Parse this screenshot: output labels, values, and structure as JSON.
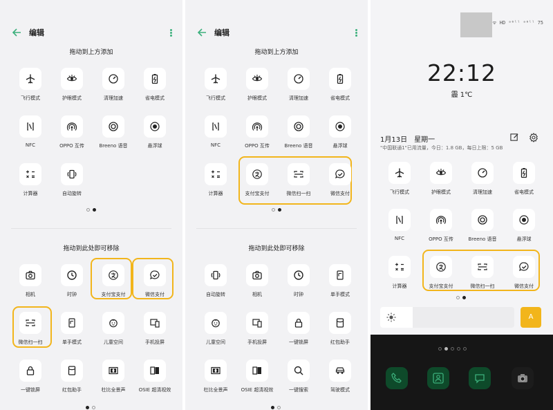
{
  "editor": {
    "title": "编辑",
    "add_section_title": "拖动到上方添加",
    "remove_section_title": "拖动到此处即可移除"
  },
  "panel1": {
    "available": [
      {
        "label": "飞行模式",
        "icon": "airplane-icon"
      },
      {
        "label": "护眼模式",
        "icon": "eye-icon"
      },
      {
        "label": "清理加速",
        "icon": "speed-icon"
      },
      {
        "label": "省电模式",
        "icon": "battery-icon"
      },
      {
        "label": "NFC",
        "icon": "nfc-icon"
      },
      {
        "label": "OPPO 互传",
        "icon": "share-icon"
      },
      {
        "label": "Breeno 语音",
        "icon": "voice-icon"
      },
      {
        "label": "悬浮球",
        "icon": "float-ball-icon"
      },
      {
        "label": "计算器",
        "icon": "calculator-icon"
      },
      {
        "label": "自动旋转",
        "icon": "rotate-icon"
      }
    ],
    "removable": [
      {
        "label": "相机",
        "icon": "camera-icon"
      },
      {
        "label": "时钟",
        "icon": "clock-icon"
      },
      {
        "label": "支付宝支付",
        "icon": "alipay-icon"
      },
      {
        "label": "微信支付",
        "icon": "wechat-pay-icon"
      },
      {
        "label": "微信扫一扫",
        "icon": "scan-icon"
      },
      {
        "label": "单手模式",
        "icon": "one-hand-icon"
      },
      {
        "label": "儿童空间",
        "icon": "kid-icon"
      },
      {
        "label": "手机投屏",
        "icon": "cast-icon"
      },
      {
        "label": "一键锁屏",
        "icon": "lock-icon"
      },
      {
        "label": "红包助手",
        "icon": "redpacket-icon"
      },
      {
        "label": "杜比全景声",
        "icon": "dolby-icon"
      },
      {
        "label": "OSIE 超清视效",
        "icon": "osie-icon"
      }
    ]
  },
  "panel2": {
    "available": [
      {
        "label": "飞行模式",
        "icon": "airplane-icon"
      },
      {
        "label": "护眼模式",
        "icon": "eye-icon"
      },
      {
        "label": "清理加速",
        "icon": "speed-icon"
      },
      {
        "label": "省电模式",
        "icon": "battery-icon"
      },
      {
        "label": "NFC",
        "icon": "nfc-icon"
      },
      {
        "label": "OPPO 互传",
        "icon": "share-icon"
      },
      {
        "label": "Breeno 语音",
        "icon": "voice-icon"
      },
      {
        "label": "悬浮球",
        "icon": "float-ball-icon"
      },
      {
        "label": "计算器",
        "icon": "calculator-icon"
      },
      {
        "label": "支付宝支付",
        "icon": "alipay-icon"
      },
      {
        "label": "微信扫一扫",
        "icon": "scan-icon"
      },
      {
        "label": "微信支付",
        "icon": "wechat-pay-icon"
      }
    ],
    "removable": [
      {
        "label": "自动旋转",
        "icon": "rotate-icon"
      },
      {
        "label": "相机",
        "icon": "camera-icon"
      },
      {
        "label": "时钟",
        "icon": "clock-icon"
      },
      {
        "label": "单手模式",
        "icon": "one-hand-icon"
      },
      {
        "label": "儿童空间",
        "icon": "kid-icon"
      },
      {
        "label": "手机投屏",
        "icon": "cast-icon"
      },
      {
        "label": "一键锁屏",
        "icon": "lock-icon"
      },
      {
        "label": "红包助手",
        "icon": "redpacket-icon"
      },
      {
        "label": "杜比全景声",
        "icon": "dolby-icon"
      },
      {
        "label": "OSIE 超清视效",
        "icon": "osie-icon"
      },
      {
        "label": "一键搜索",
        "icon": "search-icon"
      },
      {
        "label": "驾驶模式",
        "icon": "car-icon"
      }
    ]
  },
  "panel3": {
    "status_icons": "ᯤ HD ᵃ⁶ˡˡ ᵃ⁶ˡˡ 75",
    "time": "22:12",
    "weather": "霾 1℃",
    "date": "1月13日",
    "weekday": "星期一",
    "usage": "\"中国联通1\"已用流量，今日：1.8 GB，每日上限：5 GB",
    "toggles": [
      {
        "label": "飞行模式",
        "icon": "airplane-icon"
      },
      {
        "label": "护眼模式",
        "icon": "eye-icon"
      },
      {
        "label": "清理加速",
        "icon": "speed-icon"
      },
      {
        "label": "省电模式",
        "icon": "battery-icon"
      },
      {
        "label": "NFC",
        "icon": "nfc-icon"
      },
      {
        "label": "OPPO 互传",
        "icon": "share-icon"
      },
      {
        "label": "Breeno 语音",
        "icon": "voice-icon"
      },
      {
        "label": "悬浮球",
        "icon": "float-ball-icon"
      },
      {
        "label": "计算器",
        "icon": "calculator-icon"
      },
      {
        "label": "支付宝支付",
        "icon": "alipay-icon"
      },
      {
        "label": "微信扫一扫",
        "icon": "scan-icon"
      },
      {
        "label": "微信支付",
        "icon": "wechat-pay-icon"
      }
    ],
    "auto_brightness_label": "A",
    "brightness_level": 0.24,
    "dock_apps": [
      {
        "icon": "phone-icon",
        "color": "#0e4a2a"
      },
      {
        "icon": "contacts-icon",
        "color": "#0e4a2a"
      },
      {
        "icon": "messages-icon",
        "color": "#0e4a2a"
      },
      {
        "icon": "camera-icon",
        "color": "#1c1c1c"
      }
    ]
  },
  "colors": {
    "accent_green": "#3cb07c",
    "highlight_yellow": "#f2b51b",
    "tile_bg": "#ffffff",
    "panel_bg": "#f2f2f4"
  }
}
